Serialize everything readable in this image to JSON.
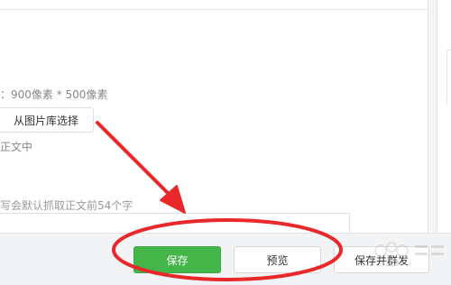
{
  "editor": {
    "size_hint": "：900像素 * 500像素",
    "library_button": "从图片库选择",
    "body_fragment": "正文中",
    "summary_hint": "写会默认抓取正文前54个字"
  },
  "toolbar": {
    "save_label": "保存",
    "preview_label": "预览",
    "save_publish_label": "保存并群发"
  },
  "colors": {
    "save_green": "#44b549",
    "annotation_red": "#e8282b"
  },
  "icons": {
    "watermark": "baidu-jingyan-logo"
  }
}
